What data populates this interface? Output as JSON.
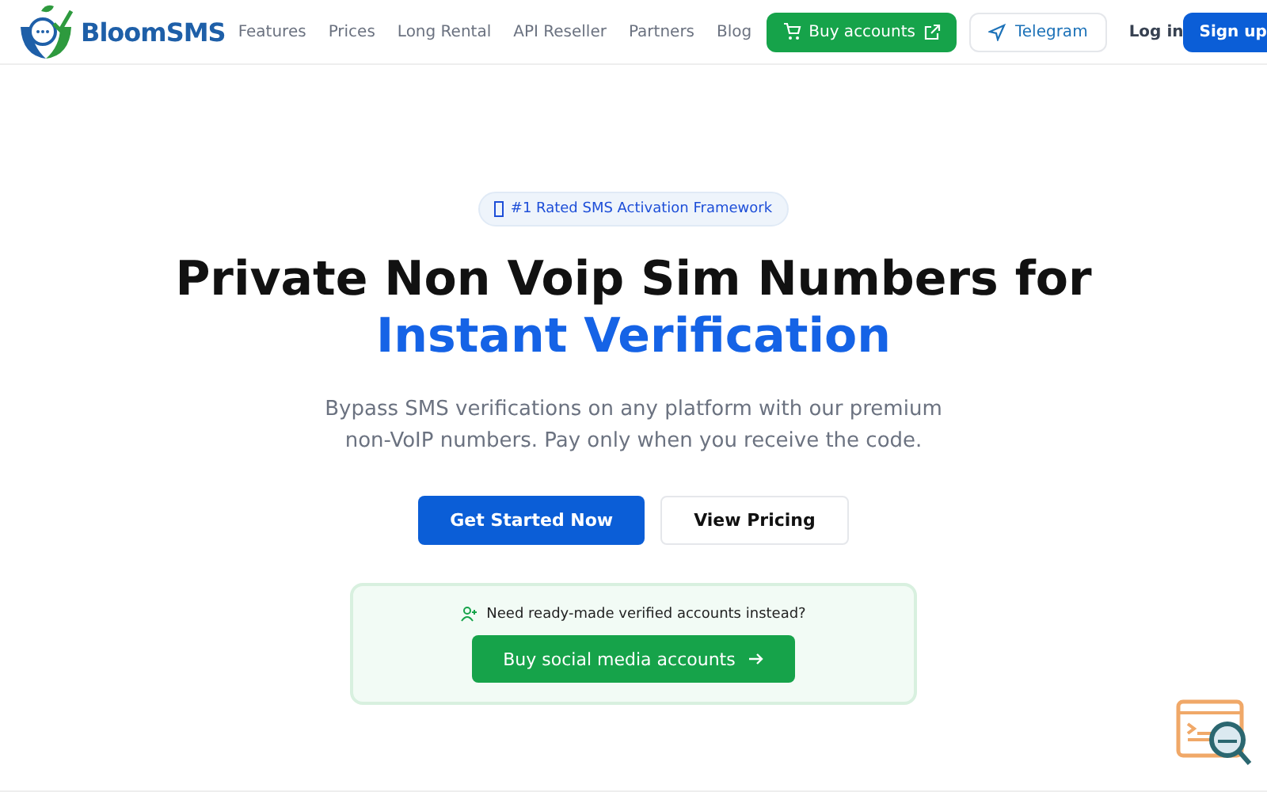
{
  "header": {
    "brand": "BloomSMS",
    "nav": [
      {
        "label": "Features"
      },
      {
        "label": "Prices"
      },
      {
        "label": "Long Rental"
      },
      {
        "label": "API Reseller"
      },
      {
        "label": "Partners"
      },
      {
        "label": "Blog"
      }
    ],
    "buy_accounts": "Buy accounts",
    "telegram": "Telegram",
    "login": "Log in",
    "signup": "Sign up"
  },
  "hero": {
    "badge": "#1 Rated SMS Activation Framework",
    "title_line1": "Private Non Voip Sim Numbers for",
    "title_line2": "Instant Verification",
    "subtitle": "Bypass SMS verifications on any platform with our premium non-VoIP numbers. Pay only when you receive the code.",
    "primary_button": "Get Started Now",
    "secondary_button": "View Pricing",
    "promo": {
      "text": "Need ready-made verified accounts instead?",
      "button": "Buy social media accounts"
    }
  }
}
